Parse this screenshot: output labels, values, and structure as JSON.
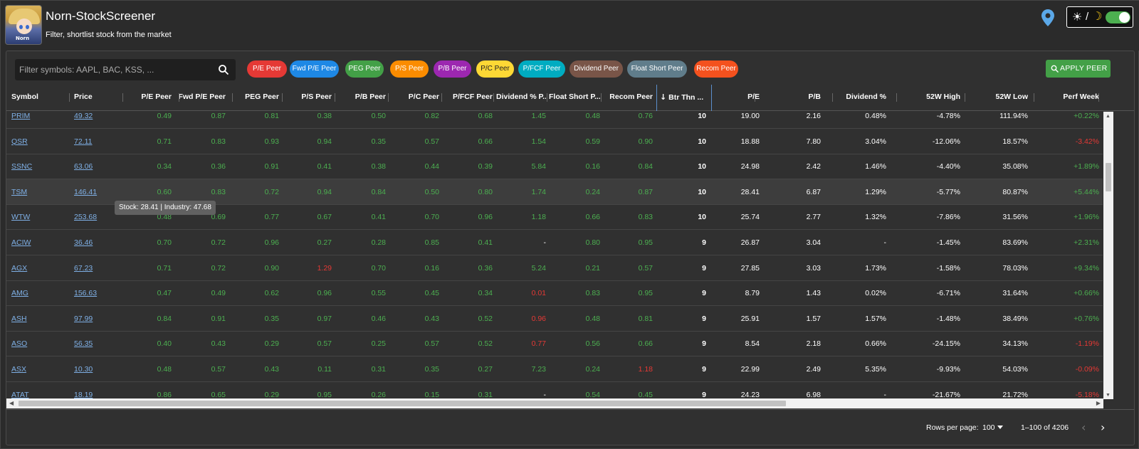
{
  "app": {
    "title": "Norn-StockScreener",
    "subtitle": "Filter, shortlist stock from the market",
    "avatar_tag": "Norn"
  },
  "theme": {
    "sun": "☀",
    "slash": "/",
    "moon": "☽",
    "dark_mode": true
  },
  "search": {
    "placeholder": "Filter symbols: AAPL, BAC, KSS, ...",
    "value": ""
  },
  "chips": [
    {
      "label": "P/E Peer",
      "color": "#e53935"
    },
    {
      "label": "Fwd P/E Peer",
      "color": "#1e88e5"
    },
    {
      "label": "PEG Peer",
      "color": "#43a047"
    },
    {
      "label": "P/S Peer",
      "color": "#fb8c00"
    },
    {
      "label": "P/B Peer",
      "color": "#9c27b0"
    },
    {
      "label": "P/C Peer",
      "color": "#fdd835"
    },
    {
      "label": "P/FCF Peer",
      "color": "#00acc1"
    },
    {
      "label": "Dividend Peer",
      "color": "#795548"
    },
    {
      "label": "Float Short Peer",
      "color": "#607d8b"
    },
    {
      "label": "Recom Peer",
      "color": "#f4511e"
    }
  ],
  "apply_label": "APPLY PEER",
  "columns": [
    "Symbol",
    "Price",
    "P/E Peer",
    "Fwd P/E Peer",
    "PEG Peer",
    "P/S Peer",
    "P/B Peer",
    "P/C Peer",
    "P/FCF Peer",
    "Dividend % P...",
    "Float Short P...",
    "Recom Peer",
    "Btr Thn ...",
    "P/E",
    "P/B",
    "Dividend %",
    "52W High",
    "52W Low",
    "Perf Week"
  ],
  "rows": [
    {
      "symbol": "PRIM",
      "price": "49.32",
      "peers": [
        "0.49",
        "0.87",
        "0.81",
        "0.38",
        "0.50",
        "0.82",
        "0.68",
        "1.45",
        "0.48",
        "0.76"
      ],
      "peer_red": [],
      "btr": "10",
      "pe": "19.00",
      "pb": "2.16",
      "div": "0.48%",
      "high": "-4.78%",
      "low": "111.94%",
      "perf": "+0.22%",
      "perf_up": true
    },
    {
      "symbol": "QSR",
      "price": "72.11",
      "peers": [
        "0.71",
        "0.83",
        "0.93",
        "0.94",
        "0.35",
        "0.57",
        "0.66",
        "1.54",
        "0.59",
        "0.90"
      ],
      "peer_red": [],
      "btr": "10",
      "pe": "18.88",
      "pb": "7.80",
      "div": "3.04%",
      "high": "-12.06%",
      "low": "18.57%",
      "perf": "-3.42%",
      "perf_up": false
    },
    {
      "symbol": "SSNC",
      "price": "63.06",
      "peers": [
        "0.34",
        "0.36",
        "0.91",
        "0.41",
        "0.38",
        "0.44",
        "0.39",
        "5.84",
        "0.16",
        "0.84"
      ],
      "peer_red": [],
      "btr": "10",
      "pe": "24.98",
      "pb": "2.42",
      "div": "1.46%",
      "high": "-4.40%",
      "low": "35.08%",
      "perf": "+1.89%",
      "perf_up": true
    },
    {
      "symbol": "TSM",
      "price": "146.41",
      "peers": [
        "0.60",
        "0.83",
        "0.72",
        "0.94",
        "0.84",
        "0.50",
        "0.80",
        "1.74",
        "0.24",
        "0.87"
      ],
      "peer_red": [],
      "btr": "10",
      "pe": "28.41",
      "pb": "6.87",
      "div": "1.29%",
      "high": "-5.77%",
      "low": "80.87%",
      "perf": "+5.44%",
      "perf_up": true
    },
    {
      "symbol": "WTW",
      "price": "253.68",
      "peers": [
        "0.48",
        "0.69",
        "0.77",
        "0.67",
        "0.41",
        "0.70",
        "0.96",
        "1.18",
        "0.66",
        "0.83"
      ],
      "peer_red": [],
      "btr": "10",
      "pe": "25.74",
      "pb": "2.77",
      "div": "1.32%",
      "high": "-7.86%",
      "low": "31.56%",
      "perf": "+1.96%",
      "perf_up": true
    },
    {
      "symbol": "ACIW",
      "price": "36.46",
      "peers": [
        "0.70",
        "0.72",
        "0.96",
        "0.27",
        "0.28",
        "0.85",
        "0.41",
        "-",
        "0.80",
        "0.95"
      ],
      "peer_red": [],
      "btr": "9",
      "pe": "26.87",
      "pb": "3.04",
      "div": "-",
      "high": "-1.45%",
      "low": "83.69%",
      "perf": "+2.31%",
      "perf_up": true
    },
    {
      "symbol": "AGX",
      "price": "67.23",
      "peers": [
        "0.71",
        "0.72",
        "0.90",
        "1.29",
        "0.70",
        "0.16",
        "0.36",
        "5.24",
        "0.21",
        "0.57"
      ],
      "peer_red": [
        3
      ],
      "btr": "9",
      "pe": "27.85",
      "pb": "3.03",
      "div": "1.73%",
      "high": "-1.58%",
      "low": "78.03%",
      "perf": "+9.34%",
      "perf_up": true
    },
    {
      "symbol": "AMG",
      "price": "156.63",
      "peers": [
        "0.47",
        "0.49",
        "0.62",
        "0.96",
        "0.55",
        "0.45",
        "0.34",
        "0.01",
        "0.83",
        "0.95"
      ],
      "peer_red": [
        7
      ],
      "btr": "9",
      "pe": "8.79",
      "pb": "1.43",
      "div": "0.02%",
      "high": "-6.71%",
      "low": "31.64%",
      "perf": "+0.66%",
      "perf_up": true
    },
    {
      "symbol": "ASH",
      "price": "97.99",
      "peers": [
        "0.84",
        "0.91",
        "0.35",
        "0.97",
        "0.46",
        "0.43",
        "0.52",
        "0.96",
        "0.48",
        "0.81"
      ],
      "peer_red": [
        7
      ],
      "btr": "9",
      "pe": "25.91",
      "pb": "1.57",
      "div": "1.57%",
      "high": "-1.48%",
      "low": "38.49%",
      "perf": "+0.76%",
      "perf_up": true
    },
    {
      "symbol": "ASO",
      "price": "56.35",
      "peers": [
        "0.40",
        "0.43",
        "0.29",
        "0.57",
        "0.25",
        "0.57",
        "0.52",
        "0.77",
        "0.56",
        "0.66"
      ],
      "peer_red": [
        7
      ],
      "btr": "9",
      "pe": "8.54",
      "pb": "2.18",
      "div": "0.66%",
      "high": "-24.15%",
      "low": "34.13%",
      "perf": "-1.19%",
      "perf_up": false
    },
    {
      "symbol": "ASX",
      "price": "10.30",
      "peers": [
        "0.48",
        "0.57",
        "0.43",
        "0.11",
        "0.31",
        "0.35",
        "0.27",
        "7.23",
        "0.24",
        "1.18"
      ],
      "peer_red": [
        9
      ],
      "btr": "9",
      "pe": "22.99",
      "pb": "2.49",
      "div": "5.35%",
      "high": "-9.93%",
      "low": "54.03%",
      "perf": "-0.09%",
      "perf_up": false
    },
    {
      "symbol": "ATAT",
      "price": "18.19",
      "peers": [
        "0.86",
        "0.65",
        "0.29",
        "0.95",
        "0.26",
        "0.15",
        "0.31",
        "-",
        "0.54",
        "0.45"
      ],
      "peer_red": [],
      "btr": "9",
      "pe": "24.23",
      "pb": "6.98",
      "div": "-",
      "high": "-21.67%",
      "low": "21.72%",
      "perf": "-5.18%",
      "perf_up": false
    }
  ],
  "tooltip": "Stock: 28.41 | Industry: 47.68",
  "footer": {
    "rows_per_page_label": "Rows per page:",
    "rows_per_page": "100",
    "range": "1–100 of 4206"
  }
}
